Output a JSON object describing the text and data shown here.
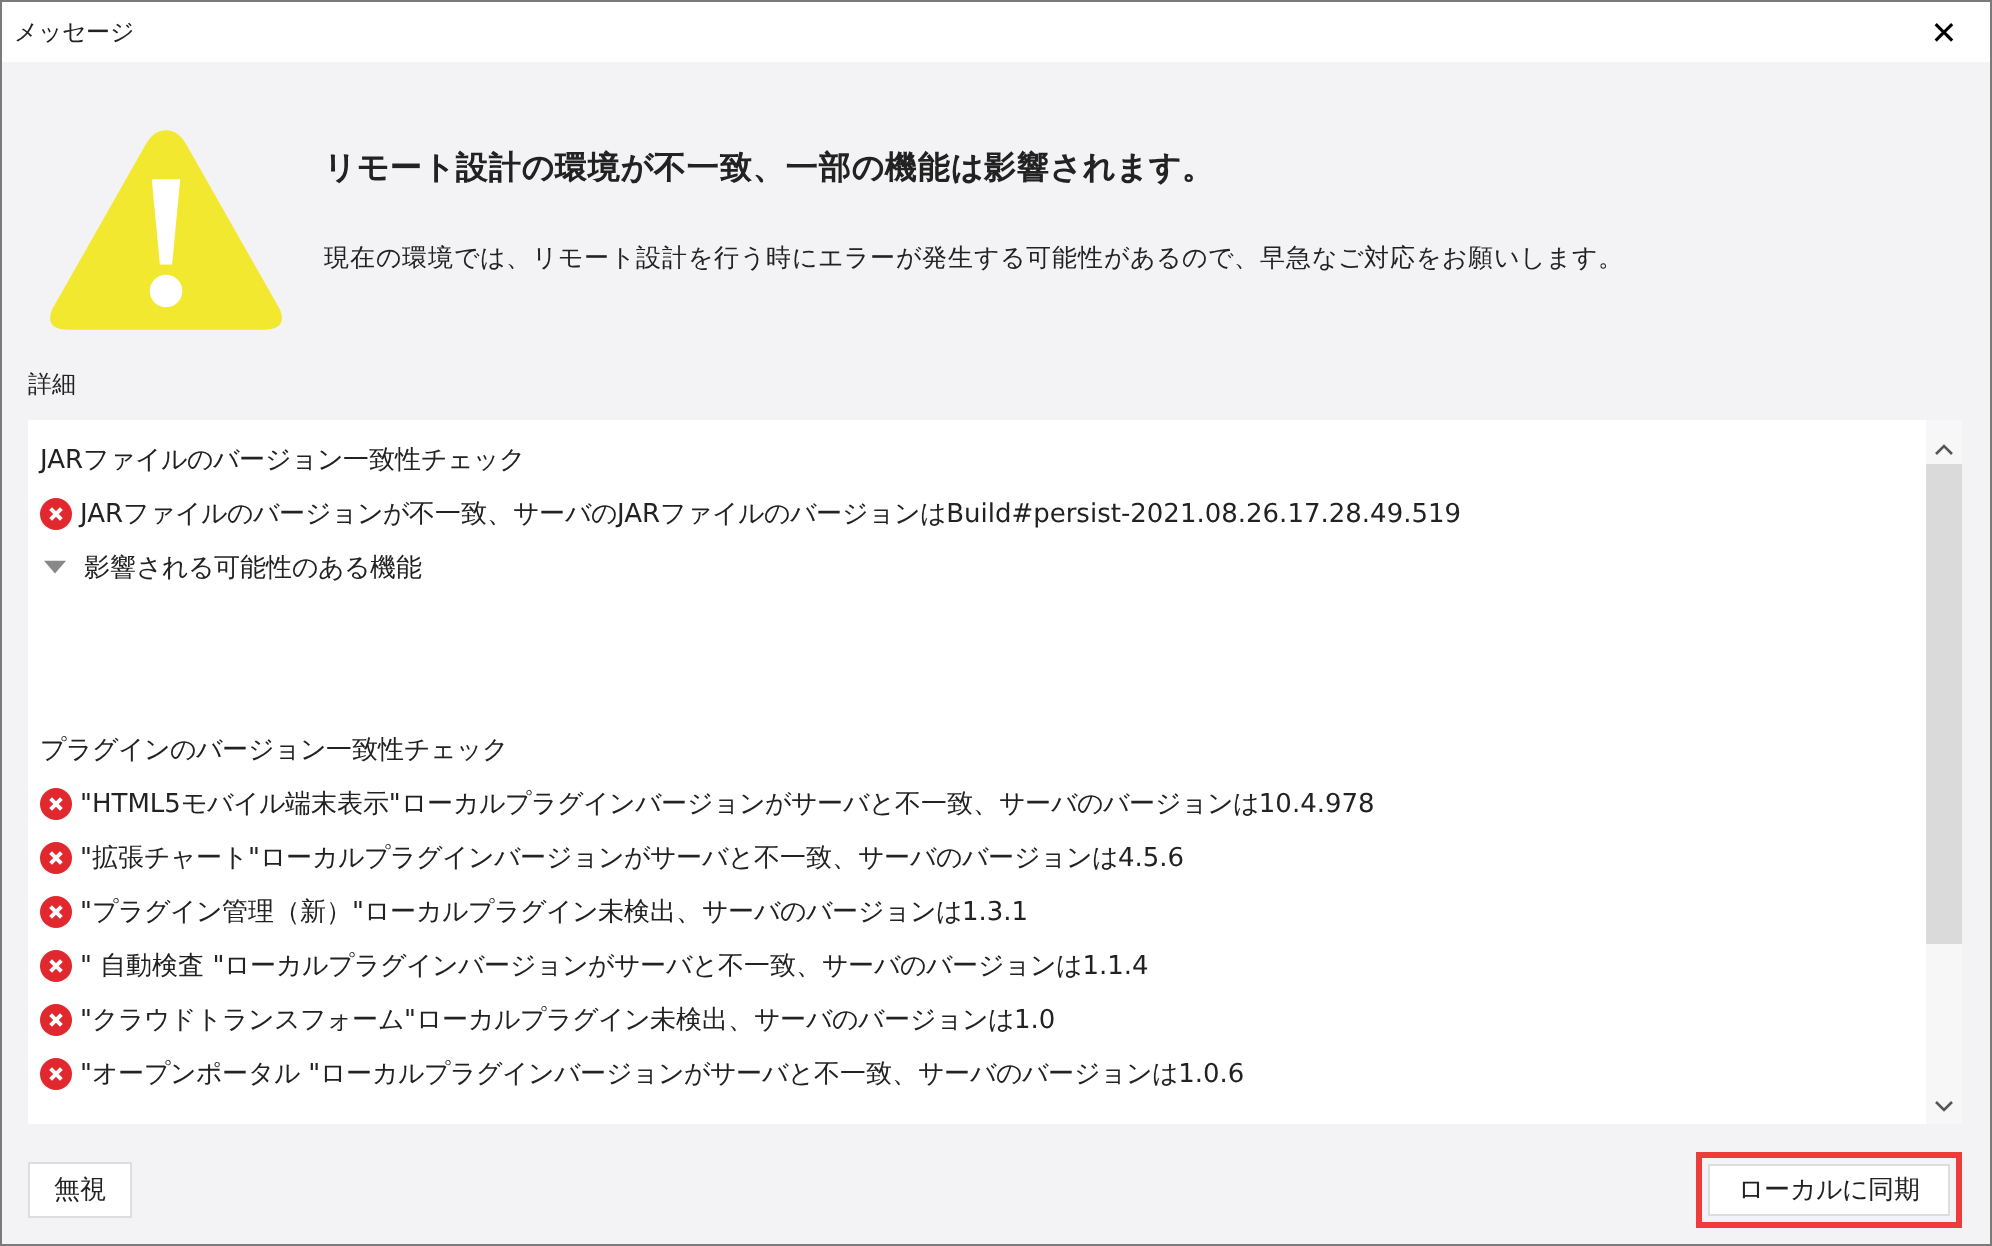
{
  "window": {
    "title": "メッセージ",
    "close": "✕"
  },
  "heading": "リモート設計の環境が不一致、一部の機能は影響されます。",
  "message": "現在の環境では、リモート設計を行う時にエラーが発生する可能性があるので、早急なご対応をお願いします。",
  "details_label": "詳細",
  "sections": [
    {
      "title": "JARファイルのバージョン一致性チェック",
      "items": [
        {
          "kind": "error",
          "text": "JARファイルのバージョンが不一致、サーバのJARファイルのバージョンはBuild#persist-2021.08.26.17.28.49.519"
        },
        {
          "kind": "group",
          "text": "影響される可能性のある機能",
          "expanded": true
        }
      ]
    },
    {
      "title": "プラグインのバージョン一致性チェック",
      "items": [
        {
          "kind": "error",
          "text": "\"HTML5モバイル端末表示\"ローカルプラグインバージョンがサーバと不一致、サーバのバージョンは10.4.978"
        },
        {
          "kind": "error",
          "text": "\"拡張チャート\"ローカルプラグインバージョンがサーバと不一致、サーバのバージョンは4.5.6"
        },
        {
          "kind": "error",
          "text": "\"プラグイン管理（新）\"ローカルプラグイン未検出、サーバのバージョンは1.3.1"
        },
        {
          "kind": "error",
          "text": "\" 自動検査 \"ローカルプラグインバージョンがサーバと不一致、サーバのバージョンは1.1.4"
        },
        {
          "kind": "error",
          "text": "\"クラウドトランスフォーム\"ローカルプラグイン未検出、サーバのバージョンは1.0"
        },
        {
          "kind": "error",
          "text": "\"オープンポータル \"ローカルプラグインバージョンがサーバと不一致、サーバのバージョンは1.0.6"
        }
      ]
    }
  ],
  "buttons": [
    {
      "label": "無視",
      "highlighted": false
    },
    {
      "label": "ローカルに同期",
      "highlighted": true
    }
  ]
}
